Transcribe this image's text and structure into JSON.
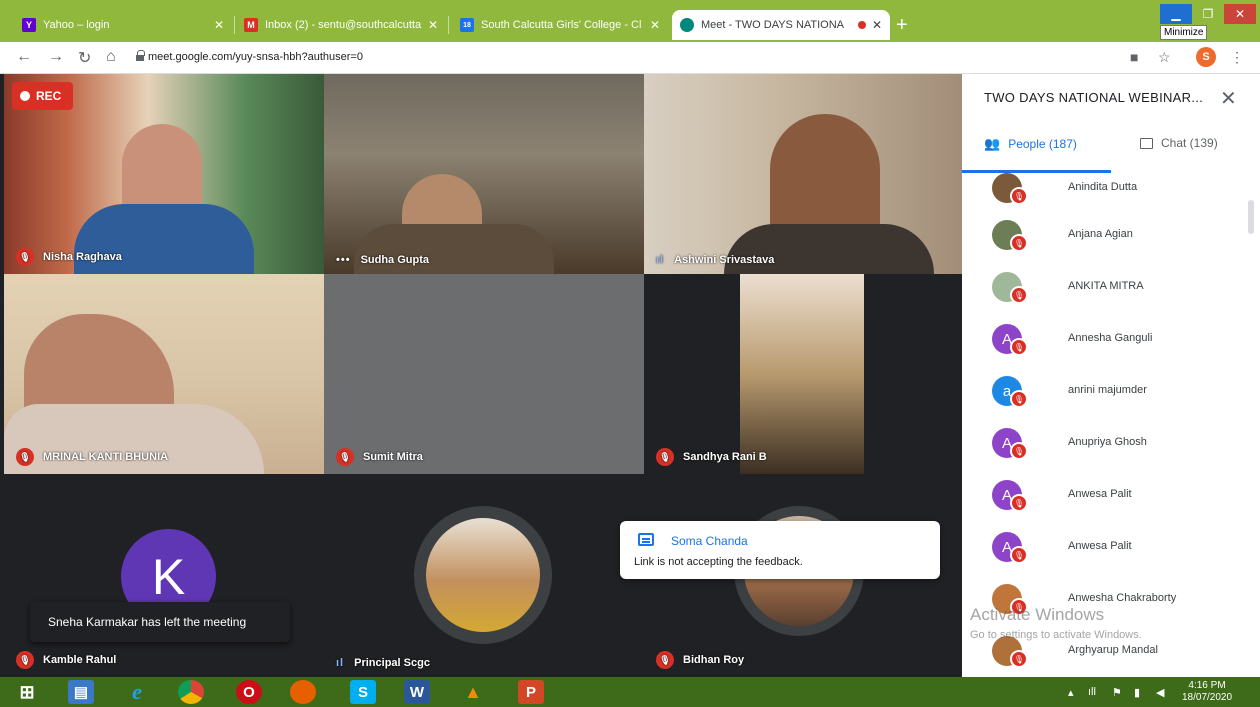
{
  "browser": {
    "tabs": [
      {
        "title": "Yahoo – login",
        "fav_letter": "Y",
        "fav_color": "#6001d2"
      },
      {
        "title": "Inbox (2) - sentu@southcalcutta",
        "fav_letter": "M",
        "fav_color": "#d93025"
      },
      {
        "title": "South Calcutta Girls' College - Cl",
        "fav_letter": "18",
        "fav_color": "#1a73e8"
      },
      {
        "title": "Meet - TWO DAYS NATIONA",
        "fav_letter": "",
        "fav_color": "#00897b"
      }
    ],
    "new_tab": "+",
    "minimize_tooltip": "Minimize",
    "url": "meet.google.com/yuy-snsa-hbh?authuser=0",
    "profile_initial": "S"
  },
  "meeting": {
    "rec_label": "REC",
    "tiles": [
      {
        "name": "Nisha Raghava",
        "status": "muted"
      },
      {
        "name": "Sudha Gupta",
        "status": "more"
      },
      {
        "name": "Ashwini Srivastava",
        "status": "speaking"
      },
      {
        "name": "MRINAL KANTI BHUNIA",
        "status": "muted"
      },
      {
        "name": "Sumit Mitra",
        "status": "muted"
      },
      {
        "name": "Sandhya Rani B",
        "status": "muted"
      },
      {
        "name": "Kamble Rahul",
        "status": "muted",
        "avatar_letter": "K"
      },
      {
        "name": "Principal Scgc",
        "status": "speaking"
      },
      {
        "name": "Bidhan Roy",
        "status": "muted"
      }
    ],
    "toast": "Sneha Karmakar has left the meeting",
    "notice": {
      "sender": "Soma Chanda",
      "message": "Link is not accepting the feedback."
    }
  },
  "panel": {
    "title": "TWO DAYS NATIONAL WEBINAR...",
    "people_tab": "People (187)",
    "chat_tab": "Chat (139)",
    "participants": [
      {
        "name": "Anindita Dutta",
        "avatar": "photo",
        "color": "#7a5a3a"
      },
      {
        "name": "Anjana Agian",
        "avatar": "photo",
        "color": "#6d7d55"
      },
      {
        "name": "ANKITA MITRA",
        "avatar": "photo",
        "color": "#9fb89a"
      },
      {
        "name": "Annesha Ganguli",
        "avatar": "A",
        "color": "#8e44c9"
      },
      {
        "name": "anrini majumder",
        "avatar": "a",
        "color": "#1e88e5"
      },
      {
        "name": "Anupriya Ghosh",
        "avatar": "A",
        "color": "#8e44c9"
      },
      {
        "name": "Anwesa Palit",
        "avatar": "A",
        "color": "#8e44c9"
      },
      {
        "name": "Anwesa Palit",
        "avatar": "A",
        "color": "#8e44c9"
      },
      {
        "name": "Anwesha Chakraborty",
        "avatar": "photo",
        "color": "#c0763a"
      },
      {
        "name": "Arghyarup Mandal",
        "avatar": "photo",
        "color": "#b0703a"
      }
    ],
    "watermark_line1": "Activate Windows",
    "watermark_line2": "Go to settings to activate Windows."
  },
  "taskbar": {
    "time": "4:16 PM",
    "date": "18/07/2020"
  }
}
